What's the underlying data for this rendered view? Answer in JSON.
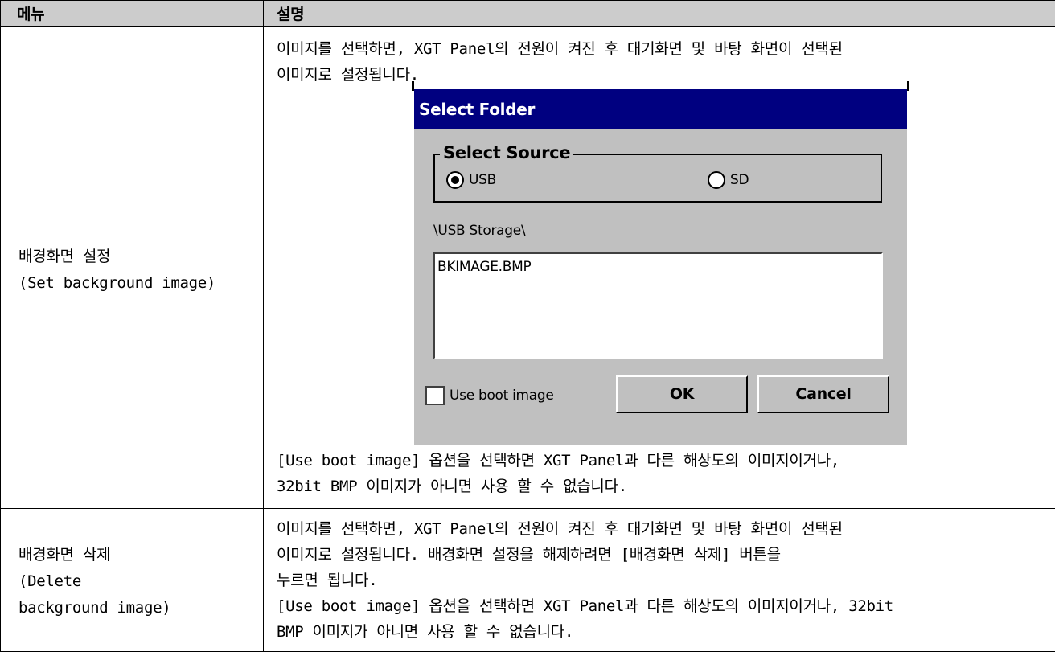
{
  "header": {
    "menu": "메뉴",
    "description": "설명"
  },
  "rows": [
    {
      "menu_lines": [
        "배경화면 설정",
        "(Set background image)"
      ],
      "desc_top": [
        "이미지를 선택하면, XGT Panel의 전원이 켜진 후 대기화면 및 바탕 화면이 선택된",
        "이미지로 설정됩니다."
      ],
      "desc_bottom": [
        "[Use boot image] 옵션을 선택하면 XGT Panel과 다른 해상도의 이미지이거나,",
        "32bit BMP 이미지가 아니면 사용 할 수 없습니다."
      ]
    },
    {
      "menu_lines": [
        "배경화면 삭제",
        "(Delete",
        "background image)"
      ],
      "desc": [
        "이미지를 선택하면, XGT Panel의 전원이 켜진 후 대기화면 및 바탕 화면이 선택된",
        "이미지로 설정됩니다. 배경화면 설정을 해제하려면 [배경화면 삭제] 버튼을",
        "누르면 됩니다.",
        "[Use boot image] 옵션을 선택하면 XGT Panel과 다른 해상도의 이미지이거나, 32bit",
        "BMP 이미지가 아니면 사용 할 수 없습니다."
      ]
    }
  ],
  "dialog": {
    "title": "Select Folder",
    "group_label": "Select Source",
    "radio_usb": "USB",
    "radio_sd": "SD",
    "selected_source": "USB",
    "path": "\\USB Storage\\",
    "files": [
      "BKIMAGE.BMP"
    ],
    "checkbox_label": "Use boot image",
    "checkbox_checked": false,
    "ok_label": "OK",
    "cancel_label": "Cancel",
    "colors": {
      "titlebar": "#000080",
      "face": "#c0c0c0"
    }
  }
}
